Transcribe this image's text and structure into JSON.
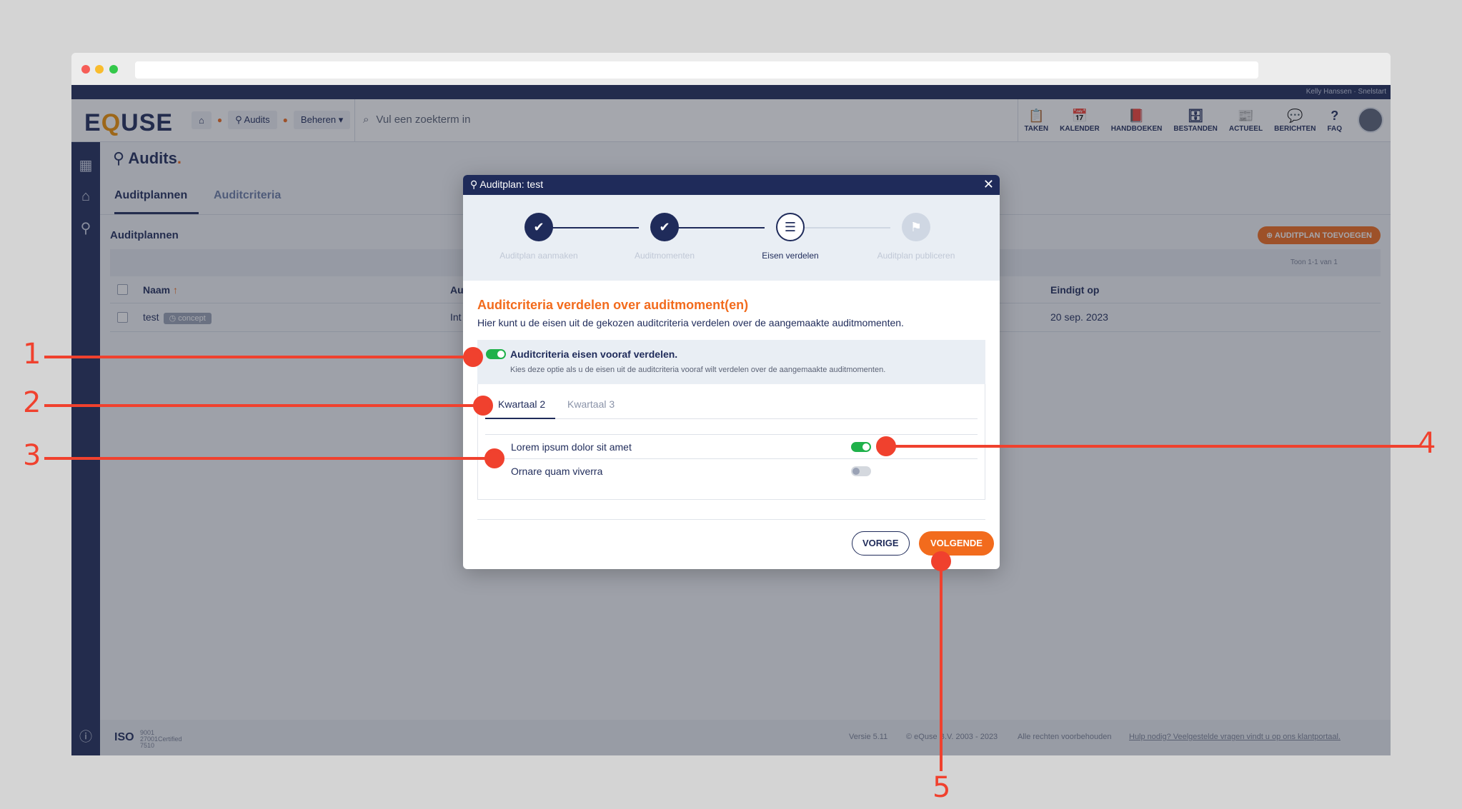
{
  "app": {
    "user_strip": "Kelly Hanssen · Snelstart",
    "logo": {
      "pre": "E",
      "q": "Q",
      "post": "USE"
    },
    "breadcrumb": {
      "audits": "Audits",
      "beheren": "Beheren"
    },
    "search_placeholder": "Vul een zoekterm in",
    "nav": [
      {
        "label": "TAKEN",
        "icon": "clipboard-icon"
      },
      {
        "label": "KALENDER",
        "icon": "calendar-icon"
      },
      {
        "label": "HANDBOEKEN",
        "icon": "book-icon"
      },
      {
        "label": "BESTANDEN",
        "icon": "archive-icon"
      },
      {
        "label": "ACTUEEL",
        "icon": "news-icon"
      },
      {
        "label": "BERICHTEN",
        "icon": "chat-icon"
      },
      {
        "label": "FAQ",
        "icon": "question-icon"
      }
    ]
  },
  "page": {
    "title": "Audits",
    "tabs": [
      "Auditplannen",
      "Auditcriteria"
    ],
    "section_title": "Auditplannen",
    "add_button": "AUDITPLAN TOEVOEGEN",
    "count_text": "Toon 1-1 van 1",
    "columns": {
      "name": "Naam",
      "audit": "Au",
      "end": "Eindigt op"
    },
    "row": {
      "name": "test",
      "badge": "concept",
      "audit": "Int",
      "end": "20 sep. 2023"
    },
    "footer": {
      "iso": "ISO",
      "iso_detail": "9001 27001Certified 7510",
      "version": "Versie 5.11",
      "copyright": "© eQuse B.V. 2003 - 2023",
      "rights": "Alle rechten voorbehouden",
      "help": "Hulp nodig? Veelgestelde vragen vindt u op ons klantportaal."
    }
  },
  "modal": {
    "title": "Auditplan: test",
    "steps": [
      {
        "label": "Auditplan aanmaken",
        "state": "done"
      },
      {
        "label": "Auditmomenten",
        "state": "done"
      },
      {
        "label": "Eisen verdelen",
        "state": "active"
      },
      {
        "label": "Auditplan publiceren",
        "state": "todo"
      }
    ],
    "heading": "Auditcriteria verdelen over auditmoment(en)",
    "subheading": "Hier kunt u de eisen uit de gekozen auditcriteria verdelen over de aangemaakte auditmomenten.",
    "option": {
      "title": "Auditcriteria eisen vooraf verdelen.",
      "description": "Kies deze optie als u de eisen uit de auditcriteria vooraf wilt verdelen over de aangemaakte auditmomenten.",
      "enabled": true
    },
    "tabs": [
      "Kwartaal 2",
      "Kwartaal 3"
    ],
    "requirements": [
      {
        "label": "Lorem ipsum dolor sit amet",
        "enabled": true
      },
      {
        "label": "Ornare quam viverra",
        "enabled": false
      }
    ],
    "prev_button": "VORIGE",
    "next_button": "VOLGENDE"
  },
  "annotations": [
    "1",
    "2",
    "3",
    "4",
    "5"
  ],
  "colors": {
    "navy": "#1f2b5a",
    "orange": "#f26b1d",
    "green": "#1fb14a",
    "callout": "#f0412e"
  }
}
